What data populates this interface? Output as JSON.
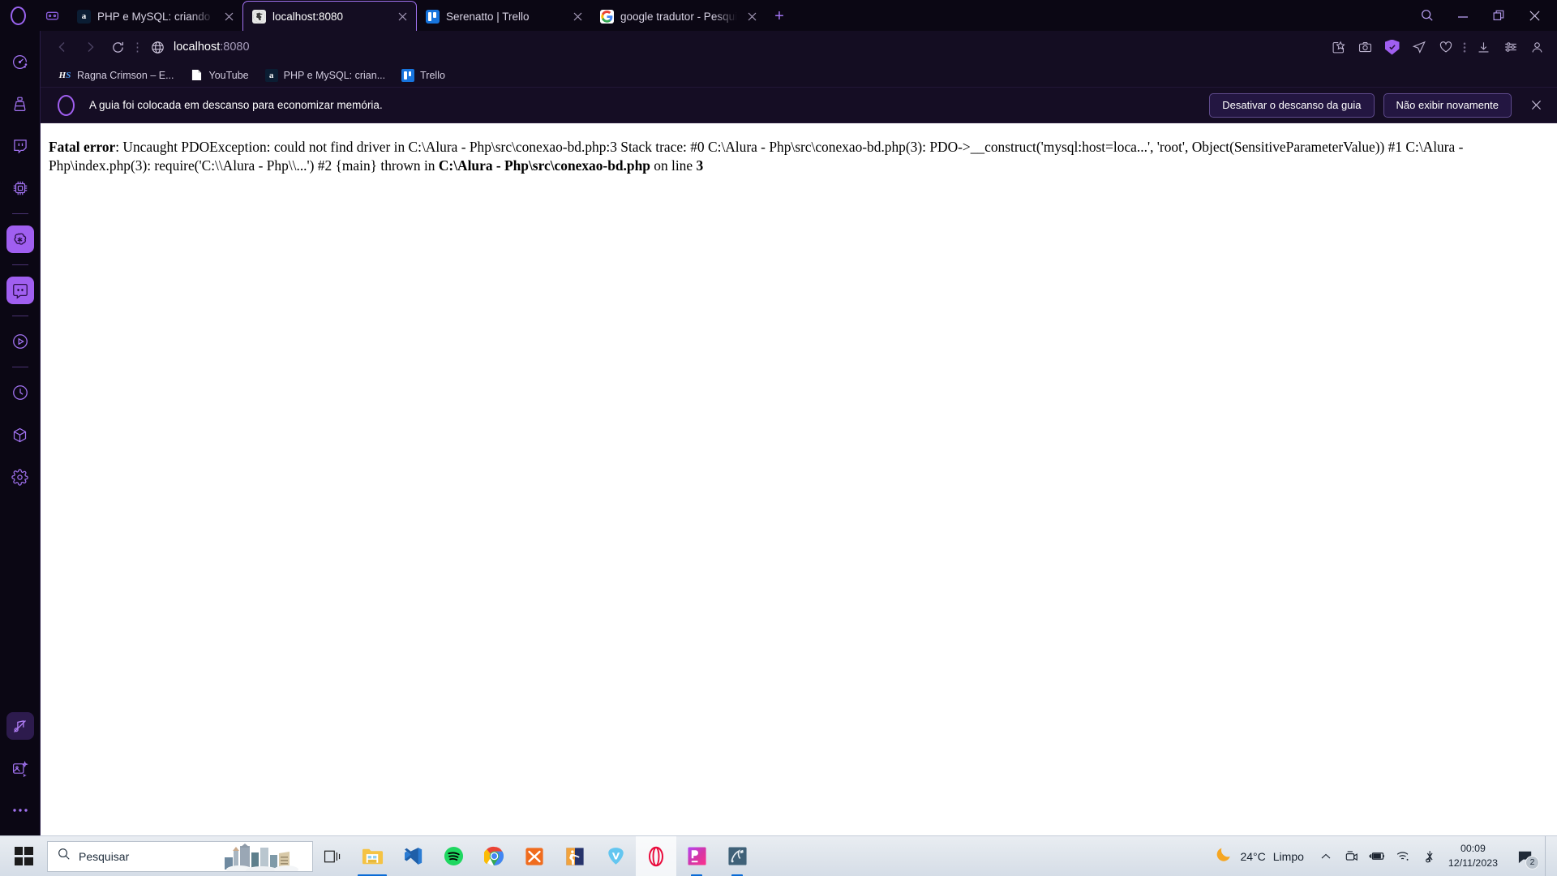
{
  "browser": {
    "name": "Opera",
    "tabs": [
      {
        "title": "PHP e MySQL: criando sua",
        "favicon": "alura-icon",
        "active": false
      },
      {
        "title": "localhost:8080",
        "favicon": "globe-dark-icon",
        "active": true
      },
      {
        "title": "Serenatto | Trello",
        "favicon": "trello-icon",
        "active": false
      },
      {
        "title": "google tradutor - Pesquisa",
        "favicon": "google-icon",
        "active": false
      }
    ],
    "new_tab_label": "+",
    "window_controls": {
      "search": "search-icon",
      "minimize": "minimize-icon",
      "maximize": "maximize-icon",
      "close": "close-icon"
    },
    "toolbar": {
      "back": "back-arrow-icon",
      "forward": "forward-arrow-icon",
      "reload": "reload-icon",
      "page_actions": "vertical-dots-icon",
      "site_icon": "globe-icon",
      "url_host": "localhost",
      "url_port": ":8080",
      "right_icons": [
        "edit-pin-icon",
        "snapshot-camera-icon",
        "vpn-shield-icon",
        "send-to-icon",
        "heart-icon",
        "vertical-dots-icon",
        "downloads-icon",
        "easy-setup-icon",
        "profile-icon"
      ]
    },
    "bookmarks": [
      {
        "label": "Ragna Crimson – E...",
        "icon": "hs-icon"
      },
      {
        "label": "YouTube",
        "icon": "document-icon"
      },
      {
        "label": "PHP e MySQL: crian...",
        "icon": "alura-icon"
      },
      {
        "label": "Trello",
        "icon": "trello-icon"
      }
    ],
    "sidebar": {
      "items": [
        {
          "name": "speed-dial-icon"
        },
        {
          "name": "cleaner-broom-icon"
        },
        {
          "name": "twitch-icon"
        },
        {
          "name": "cpu-chip-icon"
        },
        {
          "name": "chatgpt-icon"
        },
        {
          "name": "discord-icon"
        },
        {
          "name": "player-icon"
        },
        {
          "name": "history-clock-icon"
        },
        {
          "name": "cube-icon"
        },
        {
          "name": "settings-gear-icon"
        },
        {
          "name": "music-mute-icon"
        },
        {
          "name": "image-sparkle-icon"
        },
        {
          "name": "more-dots-icon"
        }
      ]
    },
    "notification": {
      "icon": "opera-logo-icon",
      "message": "A guia foi colocada em descanso para economizar memória.",
      "primary_button": "Desativar o descanso da guia",
      "secondary_button": "Não exibir novamente",
      "close": "close-icon"
    }
  },
  "page": {
    "error": {
      "label": "Fatal error",
      "segment_1": ": Uncaught PDOException: could not find driver in C:\\Alura - Php\\src\\conexao-bd.php:3 Stack trace: #0 C:\\Alura - Php\\src\\conexao-bd.php(3): PDO->__construct('mysql:host=loca...', 'root', Object(SensitiveParameterValue)) #1 C:\\Alura - Php\\index.php(3): require('C:\\\\Alura - Php\\\\...') #2 {main} thrown in ",
      "file_bold": "C:\\Alura - Php\\src\\conexao-bd.php",
      "segment_2": " on line ",
      "line_bold": "3"
    }
  },
  "taskbar": {
    "start": "windows-start-icon",
    "search_placeholder": "Pesquisar",
    "search_icon": "search-icon",
    "task_view": "task-view-icon",
    "apps": [
      {
        "name": "file-explorer-icon",
        "running": true,
        "active": false
      },
      {
        "name": "vscode-icon",
        "running": false,
        "active": false
      },
      {
        "name": "spotify-icon",
        "running": false,
        "active": false
      },
      {
        "name": "chrome-icon",
        "running": false,
        "active": false
      },
      {
        "name": "xampp-icon",
        "running": false,
        "active": false
      },
      {
        "name": "csgo-icon",
        "running": false,
        "active": false
      },
      {
        "name": "vivaldi-icon",
        "running": false,
        "active": false
      },
      {
        "name": "opera-icon",
        "running": true,
        "active": true
      },
      {
        "name": "phpstorm-icon",
        "running": true,
        "active": false
      },
      {
        "name": "mysql-workbench-icon",
        "running": true,
        "active": false
      }
    ],
    "tray": {
      "weather_icon": "moon-icon",
      "temperature": "24°C",
      "condition": "Limpo",
      "overflow": "chevron-up-icon",
      "icons": [
        "camera-privacy-icon",
        "battery-charging-icon",
        "wifi-icon",
        "bluetooth-audio-icon"
      ],
      "time": "00:09",
      "date": "12/11/2023",
      "notification_icon": "notification-icon",
      "notification_count": "2"
    }
  }
}
